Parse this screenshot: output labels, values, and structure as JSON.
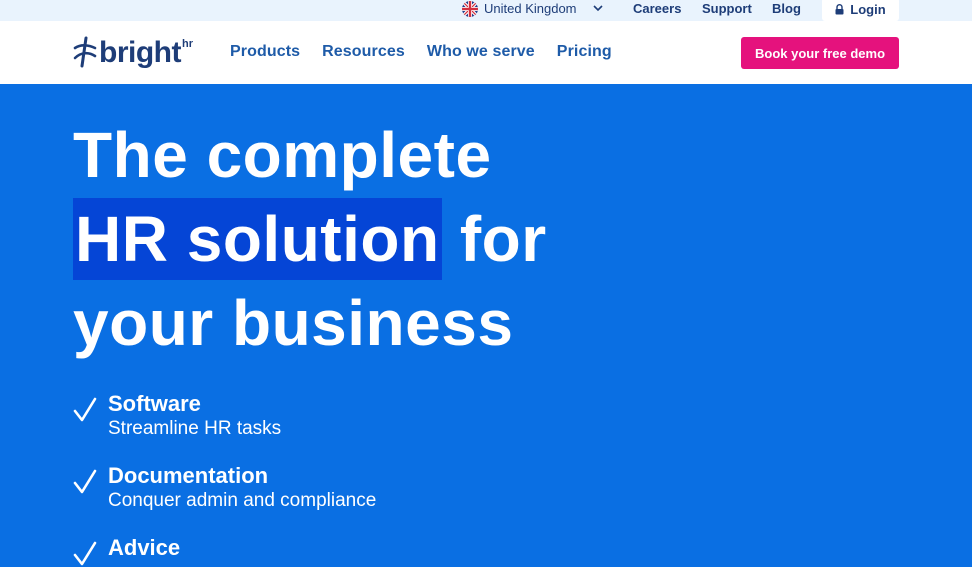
{
  "topbar": {
    "country": "United Kingdom",
    "links": [
      "Careers",
      "Support",
      "Blog"
    ],
    "login": "Login"
  },
  "nav": {
    "logo_text": "bright",
    "logo_sup": "hr",
    "links": [
      "Products",
      "Resources",
      "Who we serve",
      "Pricing"
    ],
    "cta": "Book your free demo"
  },
  "hero": {
    "line1": "The complete",
    "line2_highlight": "HR solution",
    "line2_rest": " for",
    "line3": "your business",
    "features": [
      {
        "title": "Software",
        "desc": "Streamline HR tasks"
      },
      {
        "title": "Documentation",
        "desc": "Conquer admin and compliance"
      },
      {
        "title": "Advice",
        "desc": ""
      }
    ]
  },
  "colors": {
    "hero_bg": "#0A6FE3",
    "highlight": "#0545D6",
    "brand_navy": "#1E3D78",
    "cta_pink": "#E5127D",
    "topbar_bg": "#E9F3FD"
  }
}
